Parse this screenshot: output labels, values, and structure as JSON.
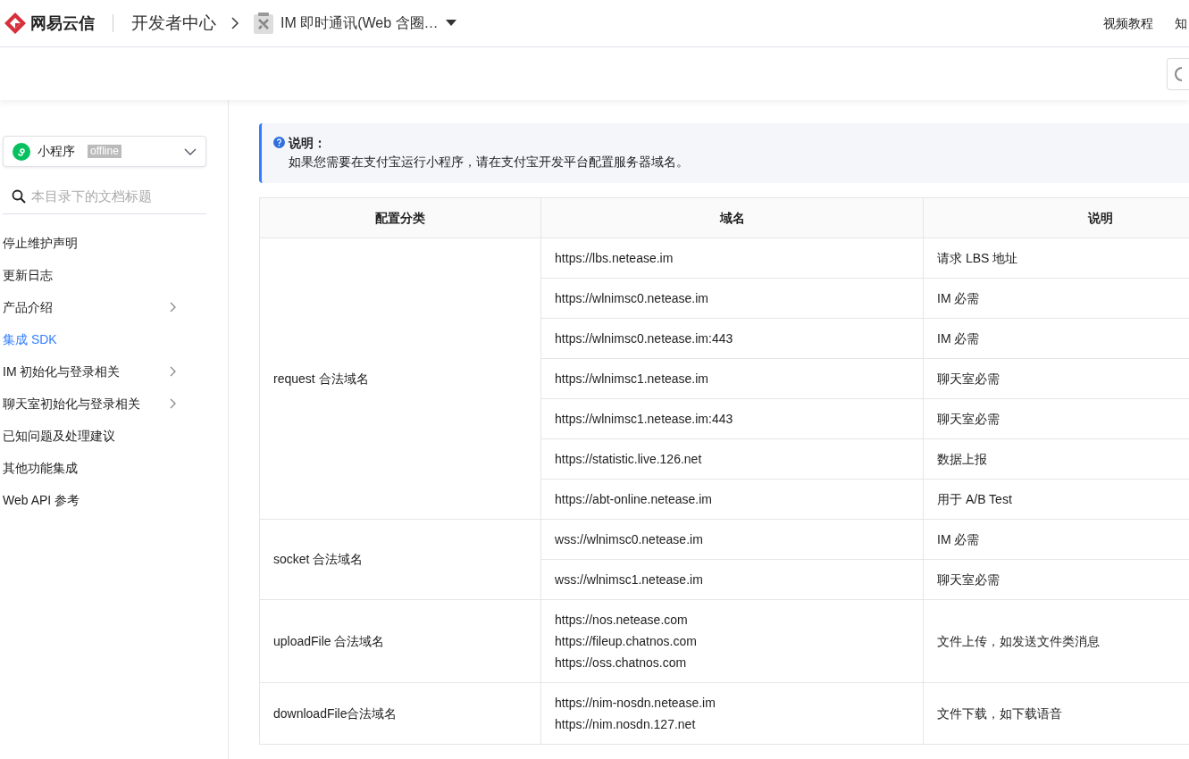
{
  "header": {
    "brand": "网易云信",
    "section": "开发者中心",
    "product": "IM 即时通讯(Web 含圈…",
    "links": [
      "视频教程",
      "知"
    ]
  },
  "sidebar": {
    "platform": {
      "label": "小程序",
      "tag": "offline"
    },
    "search": {
      "placeholder": "本目录下的文档标题"
    },
    "items": [
      {
        "label": "停止维护声明",
        "selected": false,
        "expandable": false
      },
      {
        "label": "更新日志",
        "selected": false,
        "expandable": false
      },
      {
        "label": "产品介绍",
        "selected": false,
        "expandable": true
      },
      {
        "label": "集成 SDK",
        "selected": true,
        "expandable": false
      },
      {
        "label": "IM 初始化与登录相关",
        "selected": false,
        "expandable": true
      },
      {
        "label": "聊天室初始化与登录相关",
        "selected": false,
        "expandable": true
      },
      {
        "label": "已知问题及处理建议",
        "selected": false,
        "expandable": false
      },
      {
        "label": "其他功能集成",
        "selected": false,
        "expandable": false
      },
      {
        "label": "Web API 参考",
        "selected": false,
        "expandable": false
      }
    ]
  },
  "note": {
    "title": "说明：",
    "text": "如果您需要在支付宝运行小程序，请在支付宝开发平台配置服务器域名。"
  },
  "table": {
    "columns": [
      "配置分类",
      "域名",
      "说明"
    ],
    "groups": [
      {
        "category": "request 合法域名",
        "rows": [
          {
            "domains": [
              "https://lbs.netease.im"
            ],
            "description": "请求 LBS 地址"
          },
          {
            "domains": [
              "https://wlnimsc0.netease.im"
            ],
            "description": "IM 必需"
          },
          {
            "domains": [
              "https://wlnimsc0.netease.im:443"
            ],
            "description": "IM 必需"
          },
          {
            "domains": [
              "https://wlnimsc1.netease.im"
            ],
            "description": "聊天室必需"
          },
          {
            "domains": [
              "https://wlnimsc1.netease.im:443"
            ],
            "description": "聊天室必需"
          },
          {
            "domains": [
              "https://statistic.live.126.net"
            ],
            "description": "数据上报"
          },
          {
            "domains": [
              "https://abt-online.netease.im"
            ],
            "description": "用于 A/B Test"
          }
        ]
      },
      {
        "category": "socket 合法域名",
        "rows": [
          {
            "domains": [
              "wss://wlnimsc0.netease.im"
            ],
            "description": "IM 必需"
          },
          {
            "domains": [
              "wss://wlnimsc1.netease.im"
            ],
            "description": "聊天室必需"
          }
        ]
      },
      {
        "category": "uploadFile 合法域名",
        "rows": [
          {
            "domains": [
              "https://nos.netease.com",
              "https://fileup.chatnos.com",
              "https://oss.chatnos.com"
            ],
            "description": "文件上传，如发送文件类消息"
          }
        ]
      },
      {
        "category": "downloadFile合法域名",
        "rows": [
          {
            "domains": [
              "https://nim-nosdn.netease.im",
              "https://nim.nosdn.127.net"
            ],
            "description": "文件下载，如下载语音"
          }
        ]
      }
    ]
  }
}
